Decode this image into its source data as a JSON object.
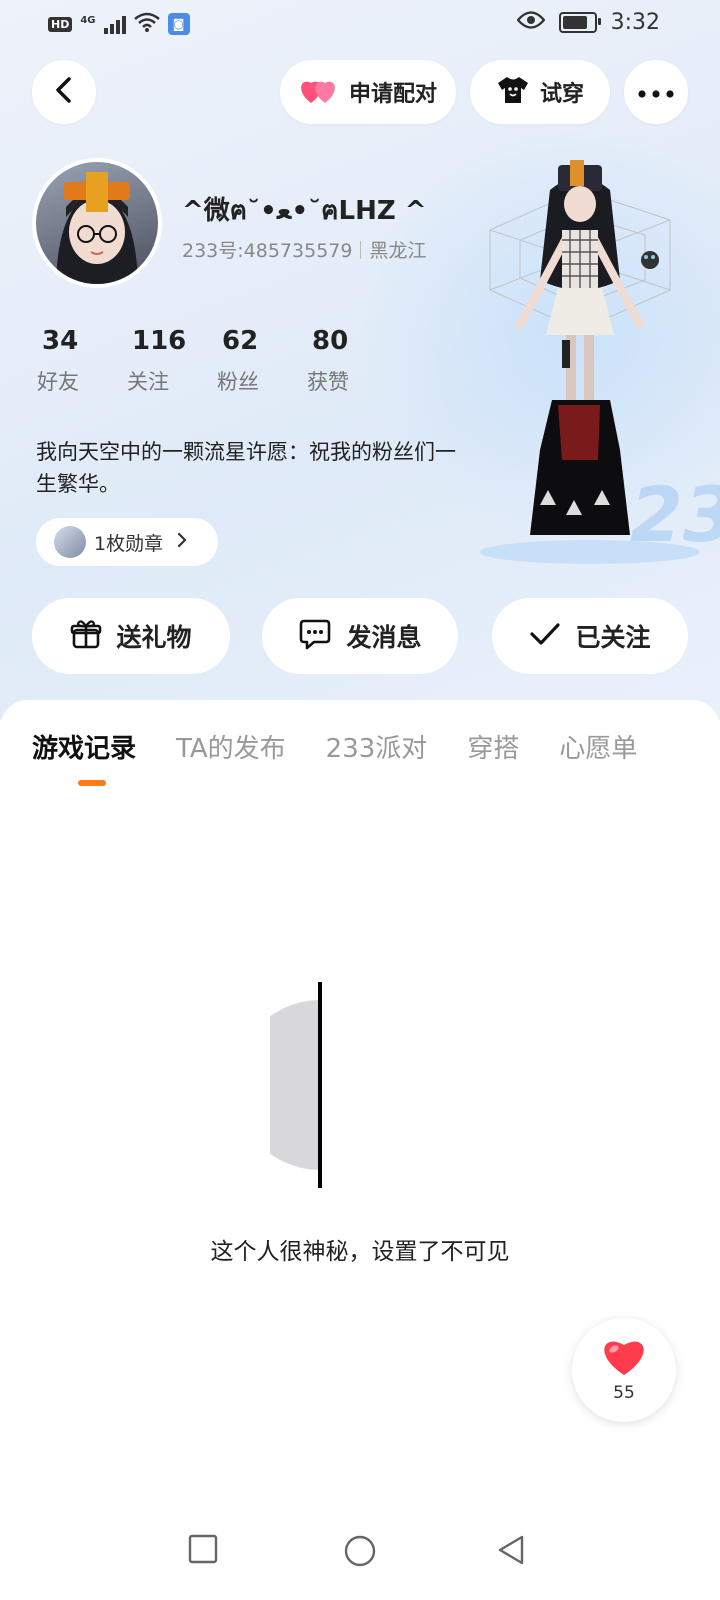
{
  "status_bar": {
    "hd": "HD",
    "network": "4G",
    "time": "3:32"
  },
  "header": {
    "pair_label": "申请配对",
    "try_on_label": "试穿"
  },
  "profile": {
    "nickname": "^微ฅ˘•ﻌ•˘ฅLHZ  ^",
    "id_text": "233号:485735579",
    "region": "黑龙江",
    "stats": [
      {
        "value": "34",
        "label": "好友"
      },
      {
        "value": "116",
        "label": "关注"
      },
      {
        "value": "62",
        "label": "粉丝"
      },
      {
        "value": "80",
        "label": "获赞"
      }
    ],
    "bio": "我向天空中的一颗流星许愿：祝我的粉丝们一生繁华。",
    "badge_label": "1枚勋章"
  },
  "actions": {
    "gift": "送礼物",
    "message": "发消息",
    "followed": "已关注"
  },
  "tabs": [
    {
      "label": "游戏记录",
      "active": true
    },
    {
      "label": "TA的发布",
      "active": false
    },
    {
      "label": "233派对",
      "active": false
    },
    {
      "label": "穿搭",
      "active": false
    },
    {
      "label": "心愿单",
      "active": false
    }
  ],
  "empty_state": {
    "text": "这个人很神秘，设置了不可见"
  },
  "like": {
    "count": "55"
  },
  "colors": {
    "accent": "#ff7a1a",
    "heart": "#ff3b4e"
  },
  "deco_text": "233"
}
